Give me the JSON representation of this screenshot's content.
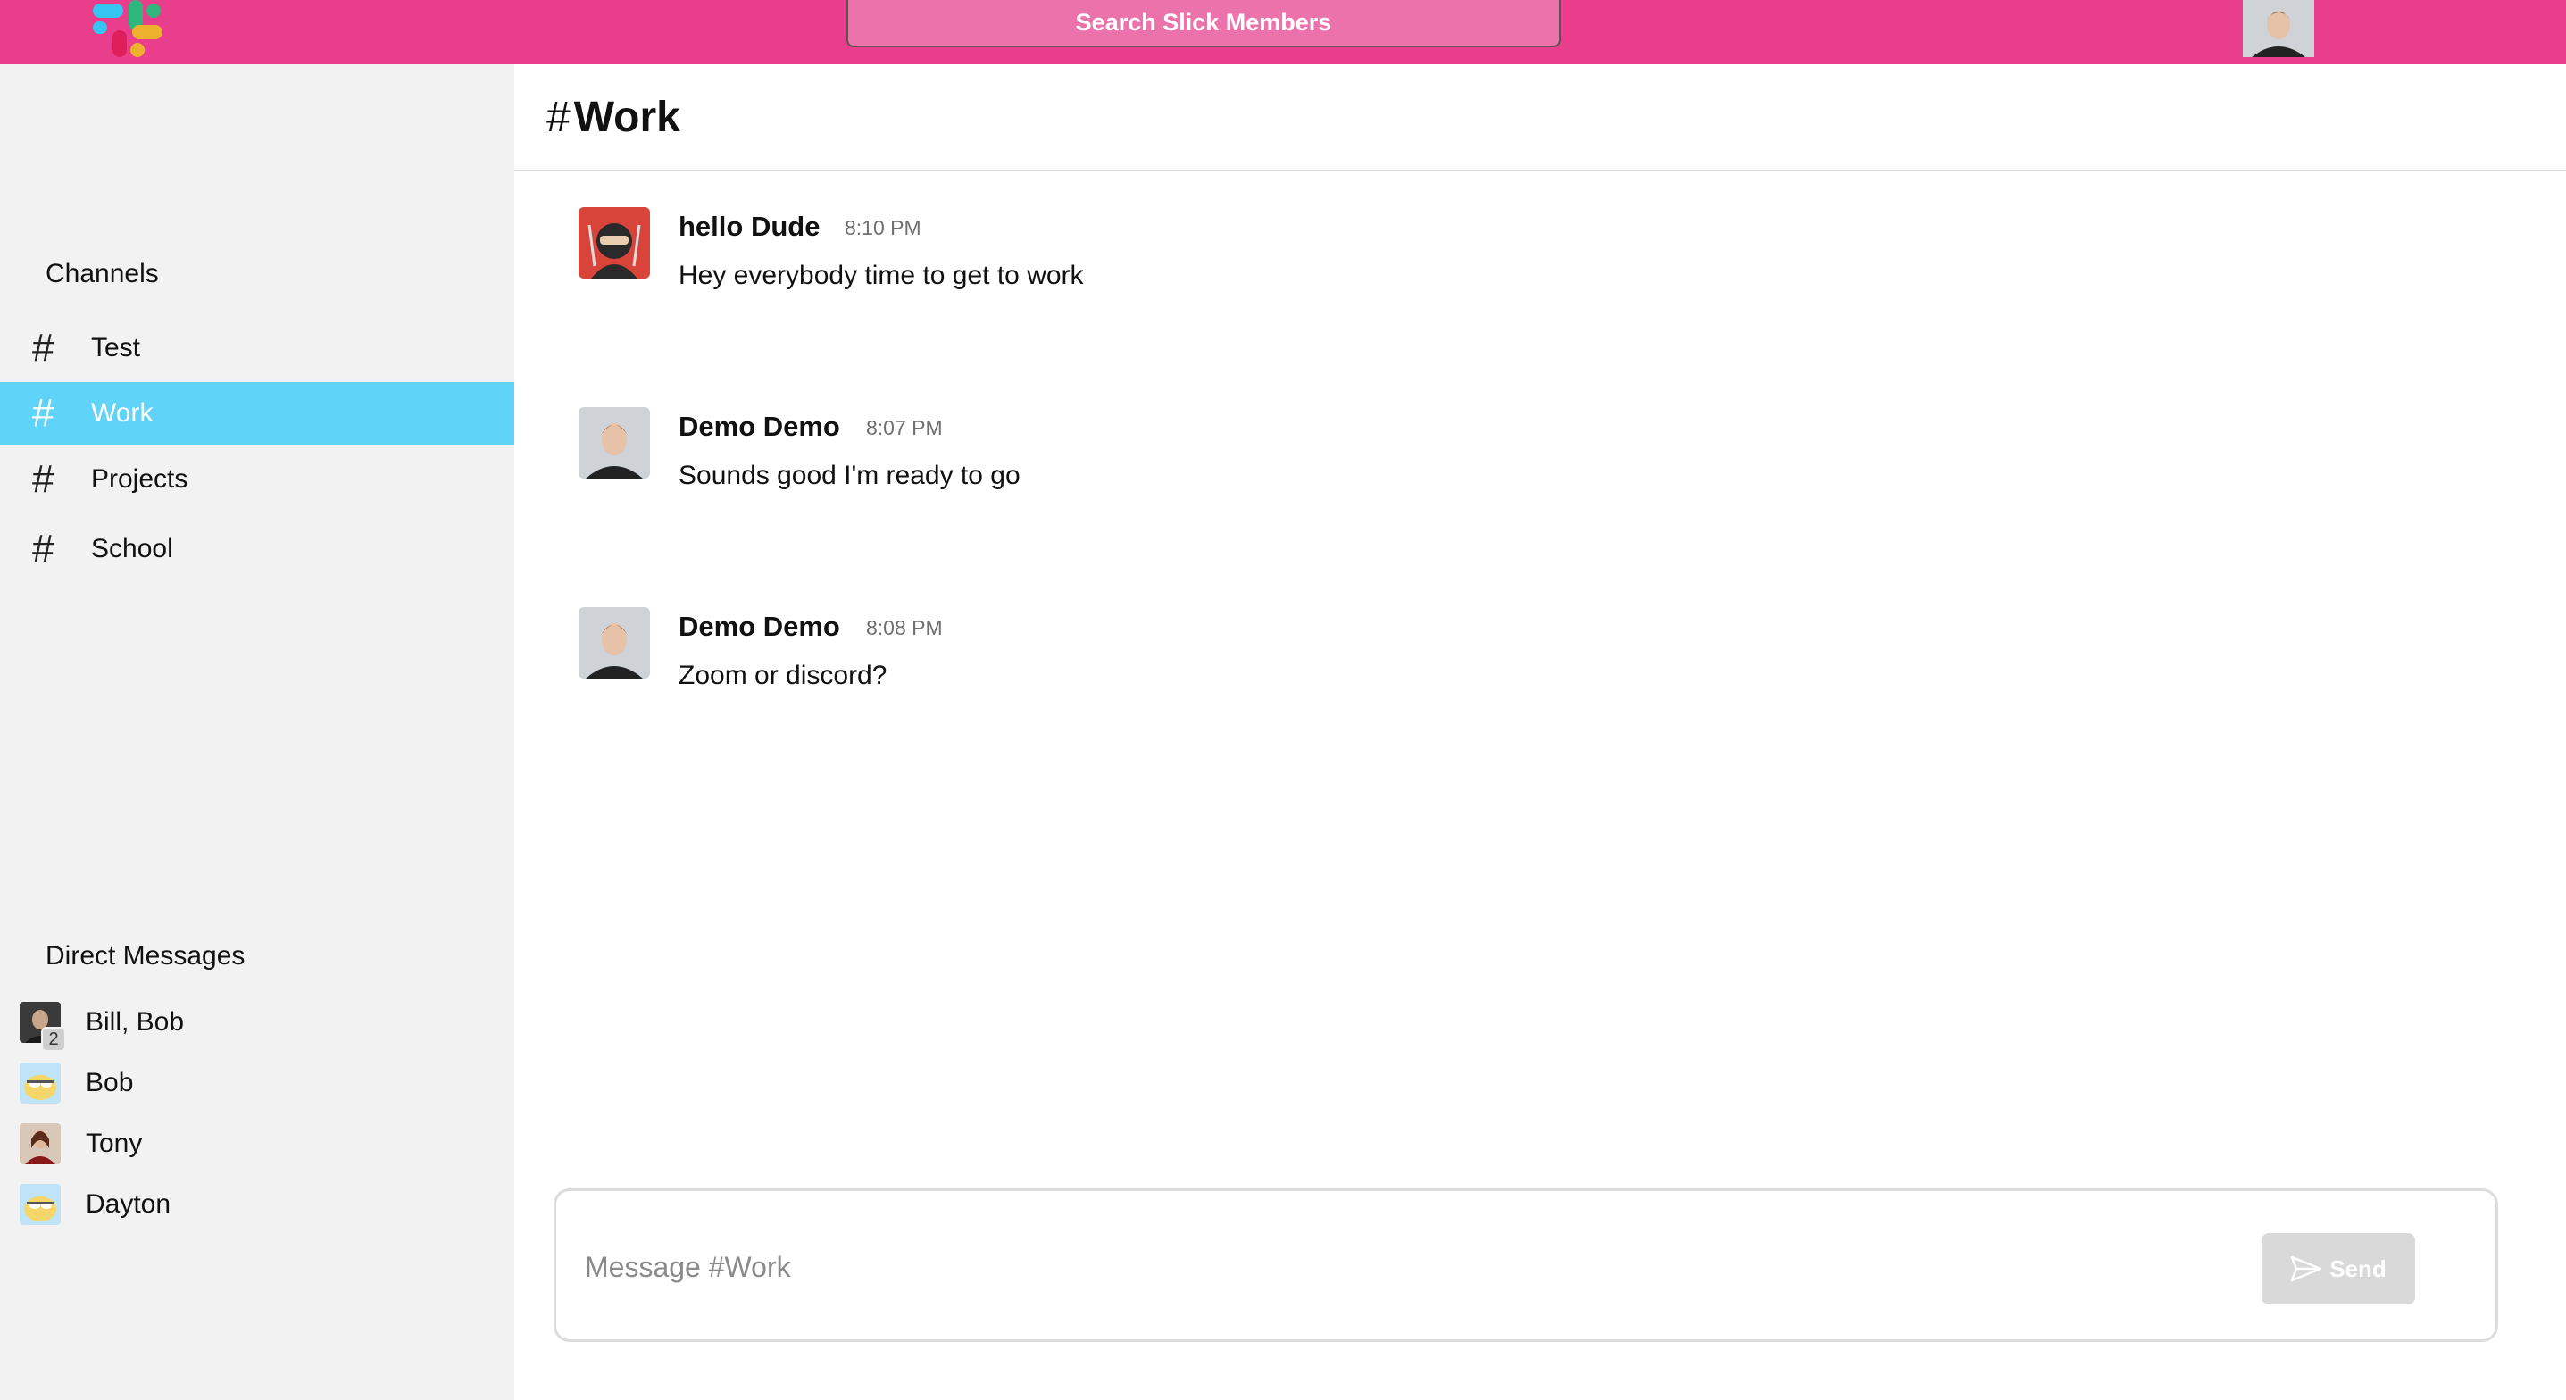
{
  "topbar": {
    "search_label": "Search Slick Members",
    "logo_icon": "slack-logo-icon",
    "avatar_icon": "user-avatar-icon",
    "background": "#e83e8c"
  },
  "sidebar": {
    "channels_title": "Channels",
    "channels": [
      {
        "label": "Test",
        "icon": "hash-icon",
        "active": false
      },
      {
        "label": "Work",
        "icon": "hash-icon",
        "active": true
      },
      {
        "label": "Projects",
        "icon": "hash-icon",
        "active": false
      },
      {
        "label": "School",
        "icon": "hash-icon",
        "active": false
      }
    ],
    "dm_title": "Direct Messages",
    "direct_messages": [
      {
        "label": "Bill, Bob",
        "badge": "2"
      },
      {
        "label": "Bob"
      },
      {
        "label": "Tony"
      },
      {
        "label": "Dayton"
      }
    ],
    "active_color": "#5fd3f8"
  },
  "main": {
    "channel_hash": "#",
    "channel_name": "Work",
    "messages": [
      {
        "author": "hello Dude",
        "time": "8:10 PM",
        "text": "Hey everybody time to get to work",
        "avatar": "ninja-avatar-icon"
      },
      {
        "author": "Demo Demo",
        "time": "8:07 PM",
        "text": "Sounds good I'm ready to go",
        "avatar": "user-avatar-icon"
      },
      {
        "author": "Demo Demo",
        "time": "8:08 PM",
        "text": "Zoom or discord?",
        "avatar": "user-avatar-icon"
      }
    ],
    "composer": {
      "placeholder": "Message #Work",
      "send_label": "Send",
      "send_icon": "paper-plane-icon"
    }
  }
}
